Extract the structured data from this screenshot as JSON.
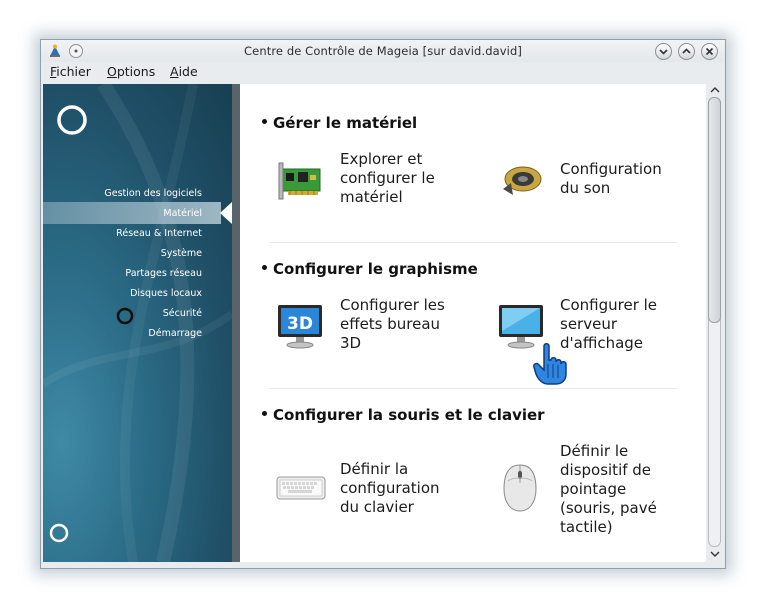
{
  "window": {
    "title": "Centre de Contrôle de Mageia  [sur david.david]"
  },
  "menubar": {
    "items": [
      "Fichier",
      "Options",
      "Aide"
    ]
  },
  "sidebar": {
    "items": [
      {
        "label": "Gestion des logiciels"
      },
      {
        "label": "Matériel",
        "selected": true
      },
      {
        "label": "Réseau & Internet"
      },
      {
        "label": "Système"
      },
      {
        "label": "Partages réseau"
      },
      {
        "label": "Disques locaux"
      },
      {
        "label": "Sécurité"
      },
      {
        "label": "Démarrage"
      }
    ]
  },
  "sections": [
    {
      "heading": "Gérer le matériel",
      "tools": [
        {
          "label": "Explorer et\nconfigurer le\nmatériel",
          "icon": "hardware-card-icon"
        },
        {
          "label": "Configuration\ndu son",
          "icon": "speaker-icon"
        }
      ]
    },
    {
      "heading": "Configurer le graphisme",
      "tools": [
        {
          "label": "Configurer les\neffets bureau\n3D",
          "icon": "3d-monitor-icon"
        },
        {
          "label": "Configurer le\nserveur\nd'affichage",
          "icon": "monitor-icon"
        }
      ]
    },
    {
      "heading": "Configurer la souris et le clavier",
      "tools": [
        {
          "label": "Définir la\nconfiguration\ndu clavier",
          "icon": "keyboard-icon"
        },
        {
          "label": "Définir le\ndispositif de\npointage\n(souris, pavé\ntactile)",
          "icon": "mouse-icon"
        }
      ]
    }
  ],
  "colors": {
    "sidebar": "#2b6b86",
    "selection": "#b4c9d4",
    "text": "#1c1c1c"
  }
}
